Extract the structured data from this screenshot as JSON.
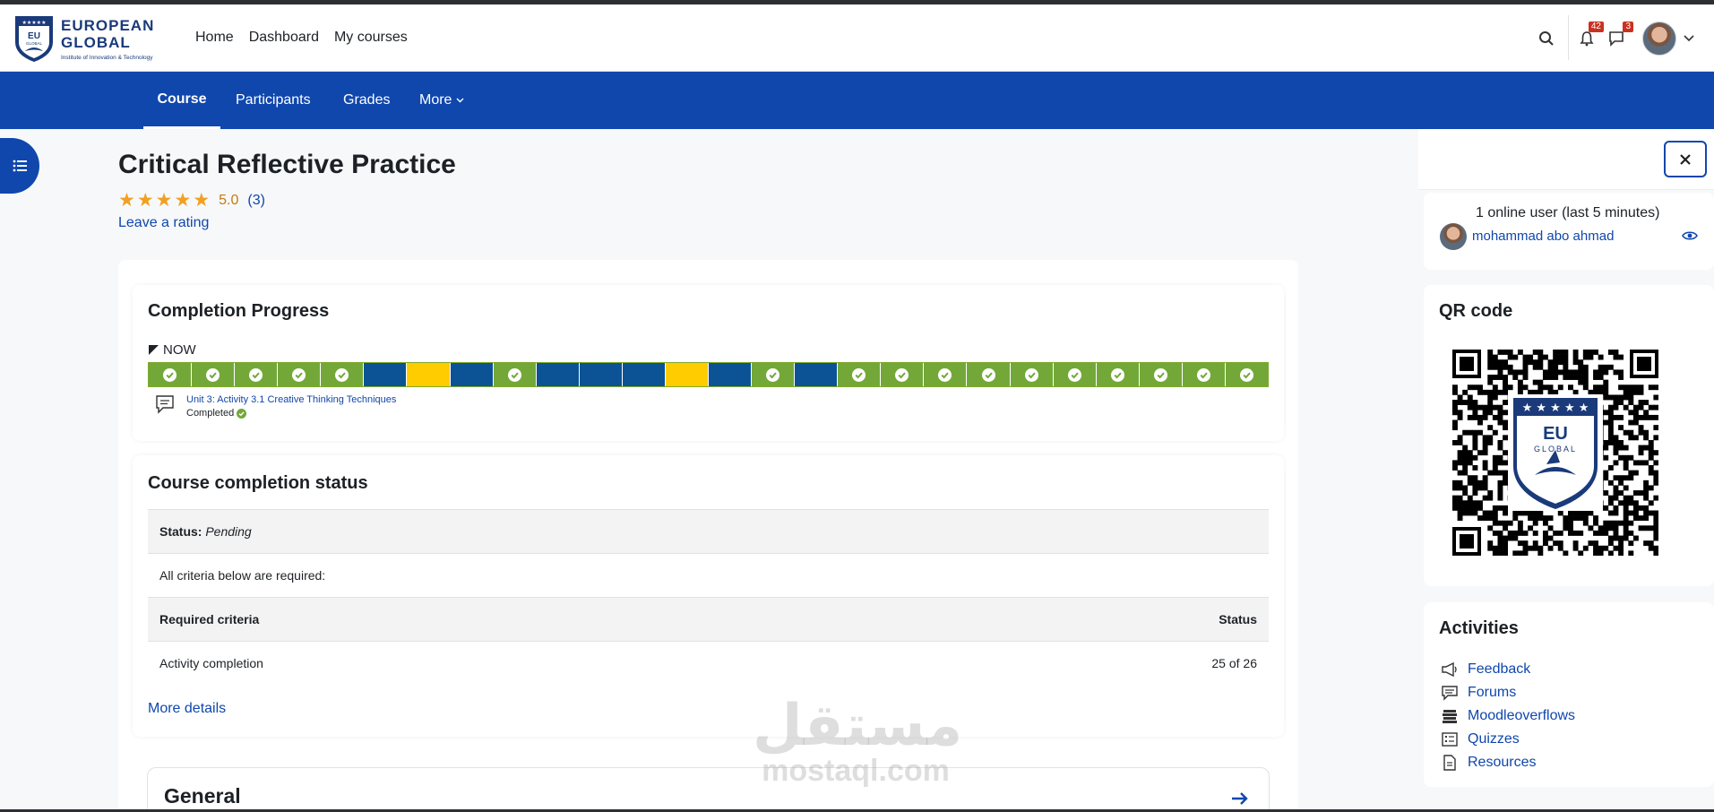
{
  "brand": {
    "line1": "EUROPEAN",
    "line2": "GLOBAL",
    "tagline": "Institute of Innovation & Technology",
    "shield_text": "EU",
    "shield_sub": "GLOBAL"
  },
  "nav": {
    "home": "Home",
    "dashboard": "Dashboard",
    "my_courses": "My courses"
  },
  "notifications": {
    "count": "42"
  },
  "messages": {
    "count": "3"
  },
  "course_nav": {
    "course": "Course",
    "participants": "Participants",
    "grades": "Grades",
    "more": "More"
  },
  "course": {
    "title": "Critical Reflective Practice",
    "rating_value": "5.0",
    "rating_count": "(3)",
    "stars": 5,
    "leave_rating": "Leave a rating"
  },
  "completion_progress": {
    "title": "Completion Progress",
    "now_label": "NOW",
    "segments": [
      "c",
      "c",
      "c",
      "c",
      "c",
      "n",
      "p",
      "n",
      "c",
      "n",
      "n",
      "n",
      "p",
      "n",
      "c",
      "n",
      "c",
      "c",
      "c",
      "c",
      "c",
      "c",
      "c",
      "c",
      "c",
      "c"
    ],
    "current_activity": "Unit 3: Activity 3.1 Creative Thinking Techniques",
    "current_status": "Completed"
  },
  "completion_status": {
    "title": "Course completion status",
    "status_label": "Status:",
    "status_value": "Pending",
    "criteria_note": "All criteria below are required:",
    "col_criteria": "Required criteria",
    "col_status": "Status",
    "row_criteria": "Activity completion",
    "row_status": "25 of 26",
    "more_details": "More details"
  },
  "section": {
    "title": "General"
  },
  "watermark": {
    "arabic": "مستقل",
    "latin": "mostaql.com"
  },
  "online_users": {
    "title": "1 online user (last 5 minutes)",
    "user": "mohammad abo ahmad"
  },
  "qr_block": {
    "title": "QR code"
  },
  "activities": {
    "title": "Activities",
    "items": [
      {
        "label": "Feedback",
        "icon": "megaphone-icon"
      },
      {
        "label": "Forums",
        "icon": "forum-icon"
      },
      {
        "label": "Moodleoverflows",
        "icon": "stack-icon"
      },
      {
        "label": "Quizzes",
        "icon": "quiz-icon"
      },
      {
        "label": "Resources",
        "icon": "file-icon"
      }
    ]
  },
  "colors": {
    "brand_blue": "#0f47ad",
    "complete_green": "#73a839",
    "notstarted_blue": "#0b5394",
    "submitted_yellow": "#ffcc00",
    "star_orange": "#f0a023",
    "badge_red": "#ca3120"
  }
}
